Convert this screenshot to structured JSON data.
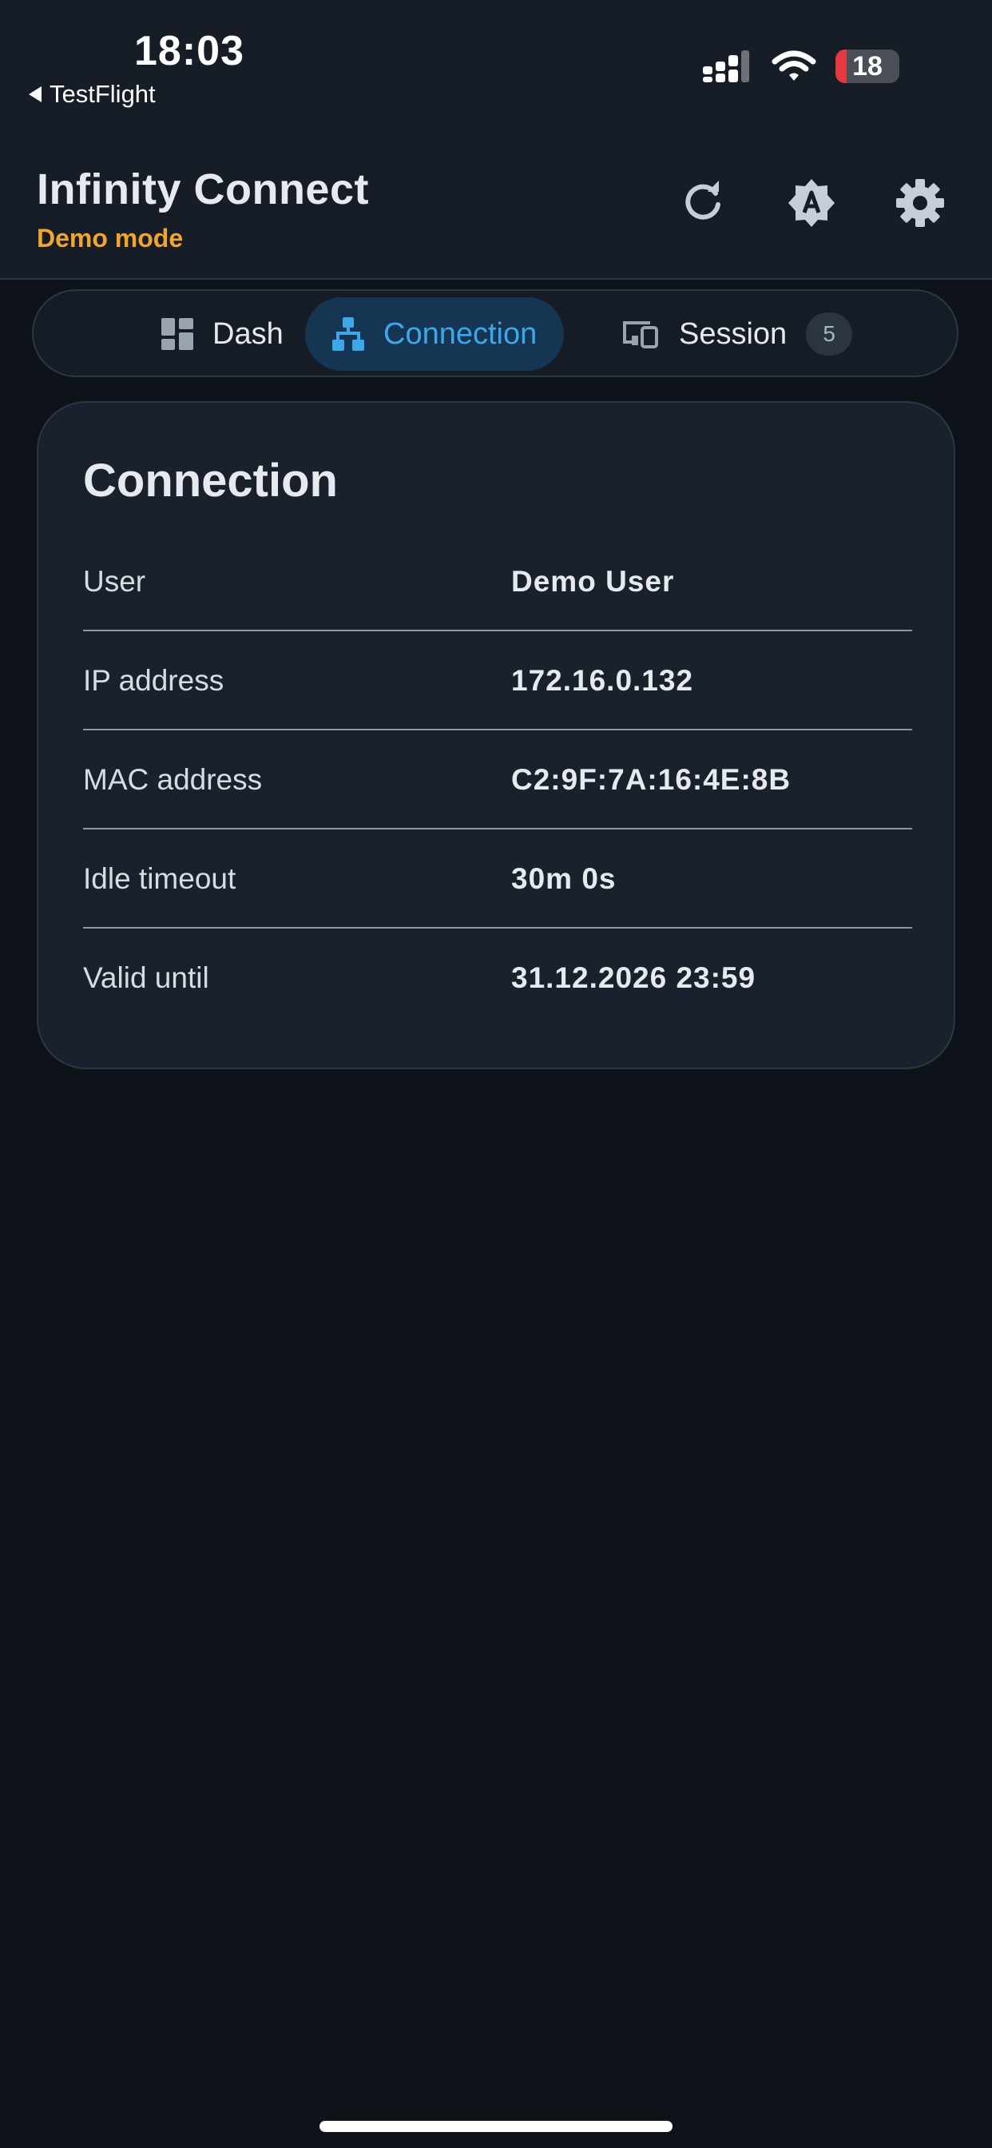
{
  "status_bar": {
    "time": "18:03",
    "back_app": "TestFlight",
    "battery_level": "18",
    "battery_fraction": 0.18
  },
  "header": {
    "title": "Infinity Connect",
    "subtitle": "Demo mode",
    "subtitle_color": "#f0a52c",
    "actions": [
      {
        "name": "refresh",
        "icon": "refresh-icon"
      },
      {
        "name": "auto-theme",
        "icon": "brightness-auto-icon"
      },
      {
        "name": "settings",
        "icon": "gear-icon"
      }
    ]
  },
  "tabs": [
    {
      "label": "Dash",
      "icon": "dashboard-icon",
      "active": false
    },
    {
      "label": "Connection",
      "icon": "network-icon",
      "active": true
    },
    {
      "label": "Session",
      "icon": "devices-icon",
      "active": false,
      "badge": "5"
    }
  ],
  "accent_color": "#3da8e9",
  "card": {
    "title": "Connection",
    "rows": [
      {
        "label": "User",
        "value": "Demo User"
      },
      {
        "label": "IP address",
        "value": "172.16.0.132"
      },
      {
        "label": "MAC address",
        "value": "C2:9F:7A:16:4E:8B"
      },
      {
        "label": "Idle timeout",
        "value": "30m 0s"
      },
      {
        "label": "Valid until",
        "value": "31.12.2026 23:59"
      }
    ]
  }
}
